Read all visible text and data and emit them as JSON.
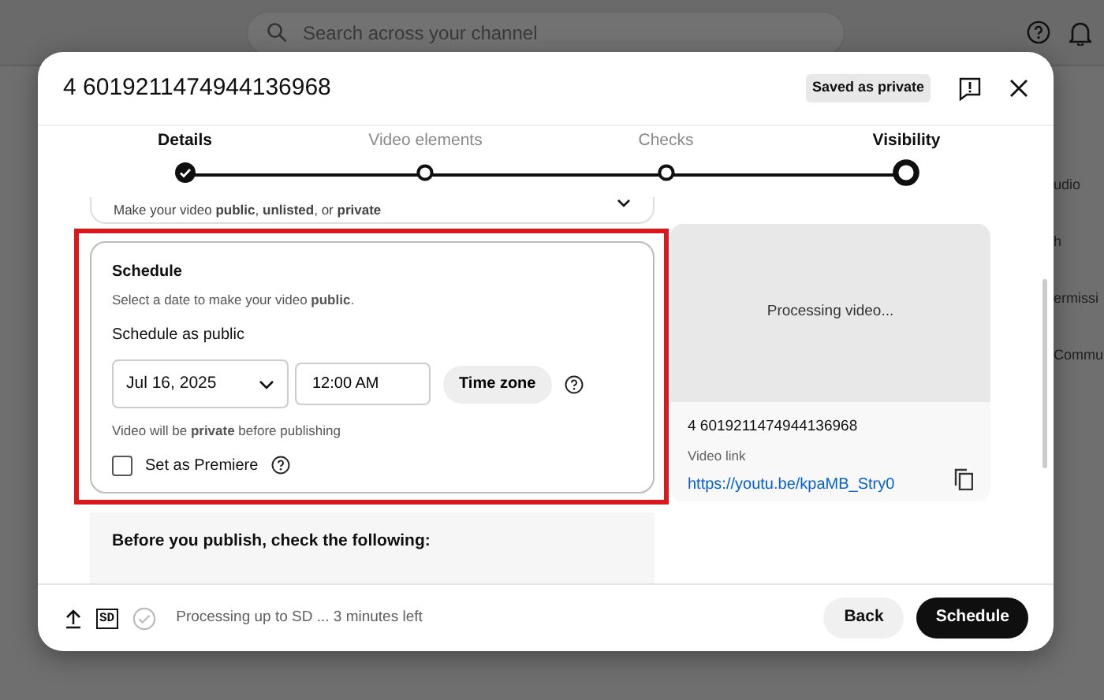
{
  "background": {
    "search_placeholder": "Search across your channel",
    "side_texts": [
      "udio",
      "h",
      "ermissi",
      "Commu"
    ]
  },
  "dialog": {
    "title": "4 6019211474944136968",
    "save_status": "Saved as private"
  },
  "steps": [
    {
      "label": "Details",
      "completed": true,
      "selected": false
    },
    {
      "label": "Video elements",
      "completed": false,
      "selected": false
    },
    {
      "label": "Checks",
      "completed": false,
      "selected": false
    },
    {
      "label": "Visibility",
      "completed": false,
      "selected": true
    }
  ],
  "visibility": {
    "hint": "Make your video **public**, **unlisted**, or **private**"
  },
  "schedule": {
    "title": "Schedule",
    "hint": "Select a date to make your video **public**.",
    "subheading": "Schedule as public",
    "date": "Jul 16, 2025",
    "time": "12:00 AM",
    "timezone_button": "Time zone",
    "note": "Video will be **private** before publishing",
    "premiere": {
      "label": "Set as Premiere",
      "checked": false
    }
  },
  "checklist": {
    "title": "Before you publish, check the following:"
  },
  "preview": {
    "status": "Processing video...",
    "file_name": "4 6019211474944136968",
    "link_label": "Video link",
    "link": "https://youtu.be/kpaMB_Stry0"
  },
  "footer": {
    "quality": "SD",
    "status": "Processing up to SD ... 3 minutes left",
    "buttons": [
      {
        "label": "Back",
        "kind": "secondary"
      },
      {
        "label": "Schedule",
        "kind": "primary"
      }
    ]
  }
}
